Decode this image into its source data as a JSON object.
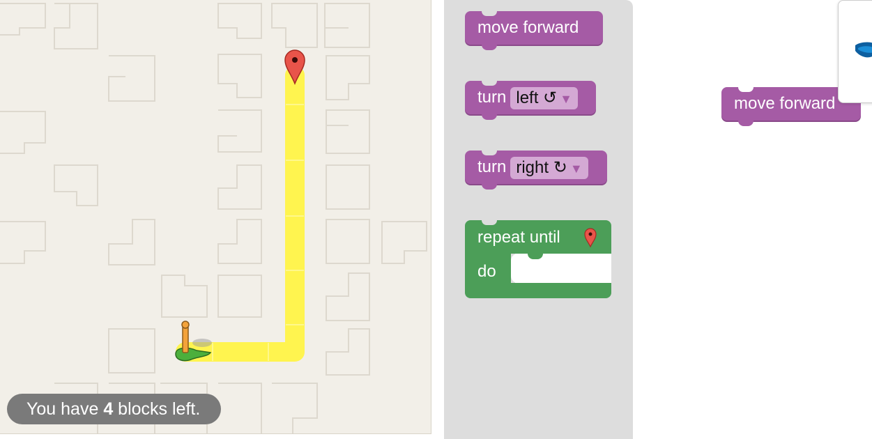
{
  "maze": {
    "status": {
      "prefix": "You have",
      "count": "4",
      "suffix": "blocks left."
    },
    "path_color": "#fff44f",
    "goal_marker": "map-pin-icon",
    "player": "pegman-icon"
  },
  "toolbox": {
    "move_forward": "move forward",
    "turn_left": {
      "label": "turn",
      "option": "left ↺"
    },
    "turn_right": {
      "label": "turn",
      "option": "right ↻"
    },
    "repeat": {
      "label": "repeat until",
      "do": "do",
      "icon": "map-pin-icon"
    }
  },
  "workspace": {
    "blocks": [
      {
        "label": "move forward"
      }
    ]
  },
  "colors": {
    "motion_block": "#a55ba5",
    "loop_block": "#4c9e58",
    "toolbox_bg": "#dddddd",
    "maze_bg": "#f2efe8"
  }
}
